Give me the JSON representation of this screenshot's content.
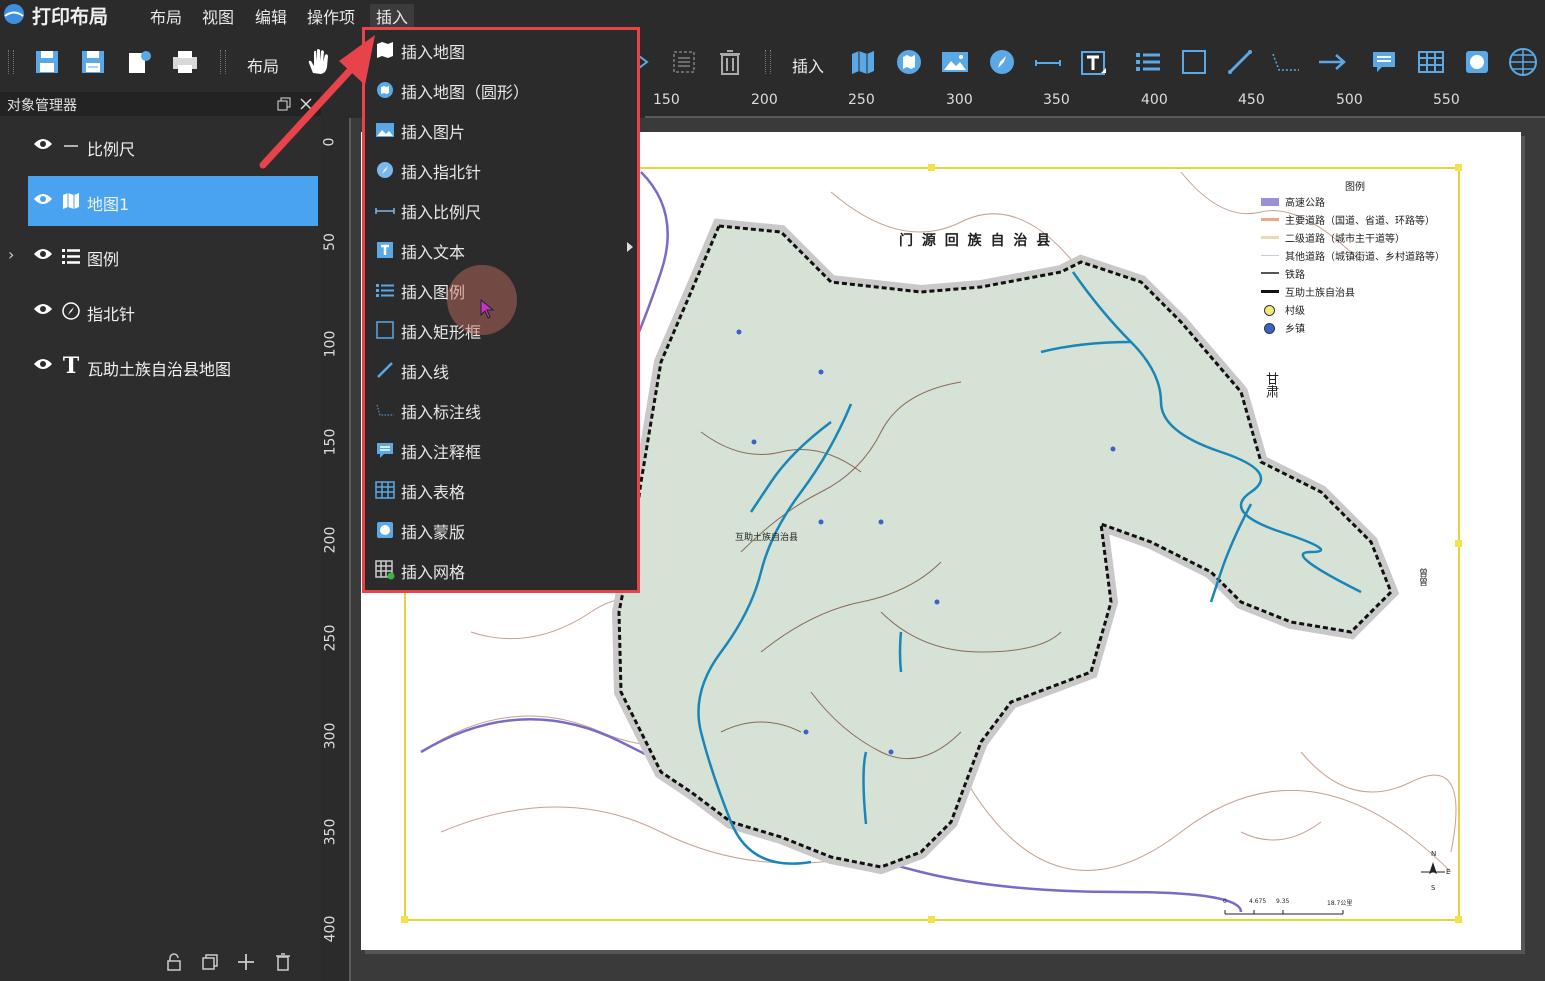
{
  "app": {
    "title": "打印布局"
  },
  "menubar": {
    "items": [
      "布局",
      "视图",
      "编辑",
      "操作项",
      "插入"
    ],
    "active": "插入"
  },
  "toolbar": {
    "layout_label": "布局",
    "insert_label": "插入"
  },
  "object_manager": {
    "title": "对象管理器",
    "items": [
      {
        "label": "比例尺",
        "icon": "scalebar-icon",
        "selected": false
      },
      {
        "label": "地图1",
        "icon": "map-icon",
        "selected": true
      },
      {
        "label": "图例",
        "icon": "legend-icon",
        "selected": false,
        "expandable": true
      },
      {
        "label": "指北针",
        "icon": "compass-icon",
        "selected": false
      },
      {
        "label": "瓦助土族自治县地图",
        "icon": "text-icon",
        "selected": false
      }
    ]
  },
  "insert_menu": {
    "items": [
      {
        "label": "插入地图",
        "icon": "map-icon"
      },
      {
        "label": "插入地图（圆形）",
        "icon": "round-map-icon"
      },
      {
        "label": "插入图片",
        "icon": "image-icon"
      },
      {
        "label": "插入指北针",
        "icon": "compass-icon"
      },
      {
        "label": "插入比例尺",
        "icon": "scalebar-icon"
      },
      {
        "label": "插入文本",
        "icon": "text-icon",
        "submenu": true
      },
      {
        "label": "插入图例",
        "icon": "legend-icon"
      },
      {
        "label": "插入矩形框",
        "icon": "rectangle-icon"
      },
      {
        "label": "插入线",
        "icon": "line-icon"
      },
      {
        "label": "插入标注线",
        "icon": "callout-line-icon"
      },
      {
        "label": "插入注释框",
        "icon": "comment-icon"
      },
      {
        "label": "插入表格",
        "icon": "table-icon"
      },
      {
        "label": "插入蒙版",
        "icon": "mask-icon"
      },
      {
        "label": "插入网格",
        "icon": "grid-icon"
      }
    ]
  },
  "ruler": {
    "top": [
      "150",
      "200",
      "250",
      "300",
      "350",
      "400",
      "450",
      "500",
      "550"
    ],
    "left": [
      "0",
      "50",
      "100",
      "150",
      "200",
      "250",
      "300",
      "350",
      "400"
    ]
  },
  "map": {
    "region_label": "门 源 回 族 自 治 县",
    "side_label_1": "甘肃",
    "side_label_2": "曾曾",
    "center_label": "互助土族自治县",
    "scale_values": [
      "0",
      "4.675",
      "9.35",
      "18.7公里"
    ],
    "north_labels": [
      "N",
      "E",
      "S"
    ]
  },
  "legend": {
    "title": "图例",
    "items": [
      {
        "label": "高速公路",
        "color": "#9b8fd6"
      },
      {
        "label": "主要道路（国道、省道、环路等）",
        "color": "#f2a58a"
      },
      {
        "label": "二级道路（城市主干道等）",
        "color": "#e6d8b8"
      },
      {
        "label": "其他道路（城镇街道、乡村道路等）",
        "color": "#cccccc"
      },
      {
        "label": "铁路",
        "color": "#555555"
      },
      {
        "label": "互助土族自治县",
        "color": "#111111"
      },
      {
        "label": "村级",
        "color": "#f5e77a"
      },
      {
        "label": "乡镇",
        "color": "#3a63c8"
      }
    ]
  },
  "colors": {
    "accent": "#4aa3f0",
    "highlight_border": "#e8434b",
    "region_fill": "#d5e2d5",
    "river": "#1a86b8"
  }
}
